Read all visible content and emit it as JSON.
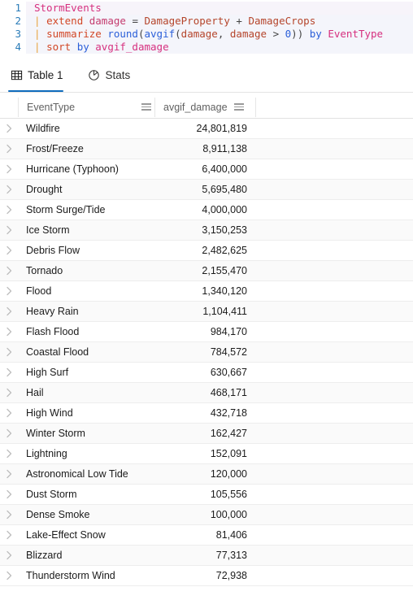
{
  "editor": {
    "lines": [
      {
        "number": "1",
        "tokens": [
          {
            "text": "StormEvents",
            "cls": "tok-table"
          }
        ]
      },
      {
        "number": "2",
        "tokens": [
          {
            "text": "| ",
            "cls": "tok-pipe"
          },
          {
            "text": "extend ",
            "cls": "tok-kw"
          },
          {
            "text": "damage ",
            "cls": "tok-var"
          },
          {
            "text": "= ",
            "cls": "tok-op"
          },
          {
            "text": "DamageProperty ",
            "cls": "tok-col"
          },
          {
            "text": "+ ",
            "cls": "tok-op"
          },
          {
            "text": "DamageCrops",
            "cls": "tok-col"
          }
        ]
      },
      {
        "number": "3",
        "tokens": [
          {
            "text": "| ",
            "cls": "tok-pipe"
          },
          {
            "text": "summarize ",
            "cls": "tok-kw"
          },
          {
            "text": "round",
            "cls": "tok-func"
          },
          {
            "text": "(",
            "cls": "tok-punct"
          },
          {
            "text": "avgif",
            "cls": "tok-func"
          },
          {
            "text": "(",
            "cls": "tok-punct"
          },
          {
            "text": "damage",
            "cls": "tok-col"
          },
          {
            "text": ", ",
            "cls": "tok-punct"
          },
          {
            "text": "damage ",
            "cls": "tok-col"
          },
          {
            "text": "> ",
            "cls": "tok-op"
          },
          {
            "text": "0",
            "cls": "tok-num"
          },
          {
            "text": ")) ",
            "cls": "tok-punct"
          },
          {
            "text": "by ",
            "cls": "tok-func"
          },
          {
            "text": "EventType",
            "cls": "tok-ident"
          }
        ]
      },
      {
        "number": "4",
        "tokens": [
          {
            "text": "| ",
            "cls": "tok-pipe"
          },
          {
            "text": "sort ",
            "cls": "tok-kw"
          },
          {
            "text": "by ",
            "cls": "tok-func"
          },
          {
            "text": "avgif_damage",
            "cls": "tok-ident"
          }
        ]
      }
    ]
  },
  "tabs": [
    {
      "label": "Table 1",
      "icon": "table-grid-icon",
      "active": true
    },
    {
      "label": "Stats",
      "icon": "stats-chart-icon",
      "active": false
    }
  ],
  "table": {
    "columns": [
      {
        "label": "EventType",
        "menu_icon": "column-menu-icon"
      },
      {
        "label": "avgif_damage",
        "menu_icon": "column-menu-icon"
      }
    ],
    "rows": [
      {
        "EventType": "Wildfire",
        "avgif_damage": "24,801,819"
      },
      {
        "EventType": "Frost/Freeze",
        "avgif_damage": "8,911,138"
      },
      {
        "EventType": "Hurricane (Typhoon)",
        "avgif_damage": "6,400,000"
      },
      {
        "EventType": "Drought",
        "avgif_damage": "5,695,480"
      },
      {
        "EventType": "Storm Surge/Tide",
        "avgif_damage": "4,000,000"
      },
      {
        "EventType": "Ice Storm",
        "avgif_damage": "3,150,253"
      },
      {
        "EventType": "Debris Flow",
        "avgif_damage": "2,482,625"
      },
      {
        "EventType": "Tornado",
        "avgif_damage": "2,155,470"
      },
      {
        "EventType": "Flood",
        "avgif_damage": "1,340,120"
      },
      {
        "EventType": "Heavy Rain",
        "avgif_damage": "1,104,411"
      },
      {
        "EventType": "Flash Flood",
        "avgif_damage": "984,170"
      },
      {
        "EventType": "Coastal Flood",
        "avgif_damage": "784,572"
      },
      {
        "EventType": "High Surf",
        "avgif_damage": "630,667"
      },
      {
        "EventType": "Hail",
        "avgif_damage": "468,171"
      },
      {
        "EventType": "High Wind",
        "avgif_damage": "432,718"
      },
      {
        "EventType": "Winter Storm",
        "avgif_damage": "162,427"
      },
      {
        "EventType": "Lightning",
        "avgif_damage": "152,091"
      },
      {
        "EventType": "Astronomical Low Tide",
        "avgif_damage": "120,000"
      },
      {
        "EventType": "Dust Storm",
        "avgif_damage": "105,556"
      },
      {
        "EventType": "Dense Smoke",
        "avgif_damage": "100,000"
      },
      {
        "EventType": "Lake-Effect Snow",
        "avgif_damage": "81,406"
      },
      {
        "EventType": "Blizzard",
        "avgif_damage": "77,313"
      },
      {
        "EventType": "Thunderstorm Wind",
        "avgif_damage": "72,938"
      }
    ],
    "row_expander_icon": "chevron-right-icon"
  },
  "colors": {
    "accent": "#0f6cbd",
    "code_bg": "#f4f5fb",
    "line_number": "#2b7cb8"
  }
}
